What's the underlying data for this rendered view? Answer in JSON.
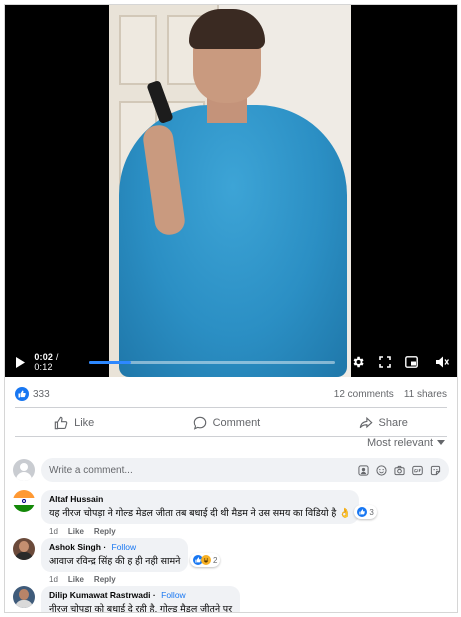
{
  "video": {
    "time_current": "0:02",
    "time_separator": " / ",
    "time_total": "0:12",
    "progress": 0.17
  },
  "stats": {
    "reaction_count": "333",
    "comments": "12 comments",
    "shares": "11 shares"
  },
  "actions": {
    "like": "Like",
    "comment": "Comment",
    "share": "Share"
  },
  "sort": {
    "label": "Most relevant"
  },
  "composer": {
    "placeholder": "Write a comment..."
  },
  "comments": [
    {
      "name": "Altaf Hussain",
      "follow": "",
      "text": "यह नीरज चोपड़ा ने गोल्ड मेडल जीता तब बधाई दी थी मैडम ने उस समय का विडियो है 👌",
      "time": "1d",
      "like": "Like",
      "reply": "Reply",
      "reactions": "3"
    },
    {
      "name": "Ashok Singh",
      "follow": "Follow",
      "text": "आवाज रविन्द्र सिंह की ह ही नही सामने",
      "time": "1d",
      "like": "Like",
      "reply": "Reply",
      "reactions": "2"
    },
    {
      "name": "Dilip Kumawat Rastrwadi",
      "follow": "Follow",
      "text": "नीरज चोपड़ा को बधाई दे रही है, गोल्ड मैडल जीतने पर",
      "time": "",
      "like": "",
      "reply": "",
      "reactions": ""
    }
  ],
  "colors": {
    "accent": "#1877f2",
    "progress": "#2d88ff",
    "video_bg": "#000000",
    "bubble": "#f0f2f5",
    "muted_text": "#65676b"
  }
}
